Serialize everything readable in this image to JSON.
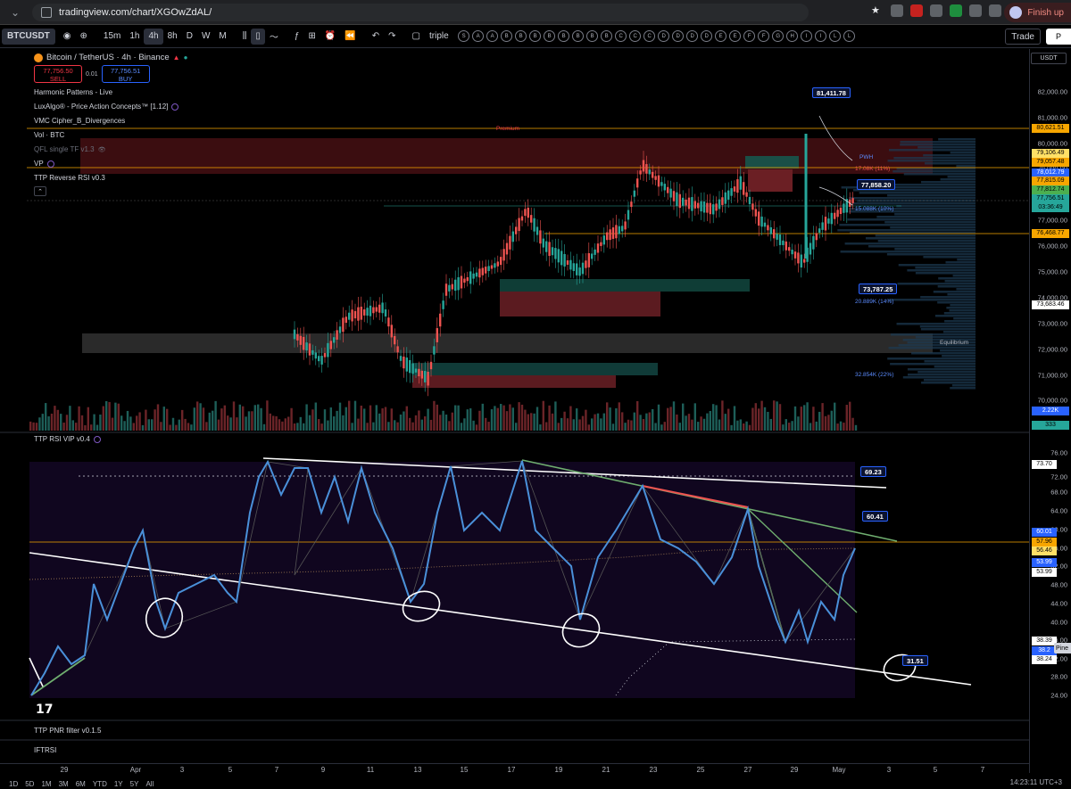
{
  "browser": {
    "url": "tradingview.com/chart/XGOwZdAL/",
    "finish_label": "Finish up"
  },
  "toolbar": {
    "symbol": "BTCUSDT",
    "intervals": [
      "15m",
      "1h",
      "4h",
      "8h",
      "D",
      "W",
      "M"
    ],
    "active_interval": "4h",
    "layout_name": "triple",
    "pattern_letters": [
      "S",
      "A",
      "A",
      "B",
      "B",
      "B",
      "B",
      "B",
      "B",
      "B",
      "B",
      "C",
      "C",
      "C",
      "D",
      "D",
      "D",
      "D",
      "E",
      "E",
      "F",
      "F",
      "G",
      "H",
      "I",
      "I",
      "L",
      "L"
    ],
    "trade_label": "Trade",
    "publish_label": "P"
  },
  "legend": {
    "title": "Bitcoin / TetherUS · 4h · Binance",
    "sell_price": "77,756.50",
    "sell_label": "SELL",
    "spread": "0.01",
    "buy_price": "77,756.51",
    "buy_label": "BUY",
    "indicators": [
      "Harmonic Patterns - Live",
      "LuxAlgo® - Price Action Concepts™ [1.12]",
      "VMC Cipher_B_Divergences",
      "Vol · BTC",
      "QFL single TF v1.3",
      "VP",
      "TTP Reverse RSI v0.3"
    ]
  },
  "currency_chip": "USDT",
  "price_axis": {
    "labels": [
      "82,000.00",
      "81,000.00",
      "80,000.00",
      "79,000.00",
      "78,000.00",
      "77,000.00",
      "76,000.00",
      "75,000.00",
      "74,000.00",
      "73,000.00",
      "72,000.00",
      "71,000.00",
      "70,000.00"
    ],
    "tags": [
      {
        "text": "80,621.51",
        "color": "#f7a600"
      },
      {
        "text": "79,106.49",
        "color": "#ffe066"
      },
      {
        "text": "79,057.48",
        "color": "#f7a600"
      },
      {
        "text": "78,012.79",
        "color": "#2962ff"
      },
      {
        "text": "77,815.09",
        "color": "#f7a600"
      },
      {
        "text": "77,812.74",
        "color": "#4caf50"
      },
      {
        "text": "77,756.51",
        "color": "#26a69a"
      },
      {
        "text": "03:36:49",
        "color": "#26a69a"
      },
      {
        "text": "76,468.77",
        "color": "#f7a600"
      },
      {
        "text": "73,683.46",
        "color": "#ffffff"
      },
      {
        "text": "2.22K",
        "color": "#2962ff"
      },
      {
        "text": "333",
        "color": "#26a69a"
      }
    ],
    "rsi_labels": [
      "76.00",
      "72.00",
      "68.00",
      "64.00",
      "60.00",
      "56.00",
      "52.00",
      "48.00",
      "44.00",
      "40.00",
      "36.00",
      "32.00",
      "28.00",
      "24.00"
    ],
    "rsi_tags": [
      {
        "text": "73.70",
        "color": "#ffffff"
      },
      {
        "text": "60.01",
        "color": "#2962ff"
      },
      {
        "text": "57.96",
        "color": "#f7a600"
      },
      {
        "text": "56.46",
        "color": "#ffe066"
      },
      {
        "text": "53.99",
        "color": "#2962ff"
      },
      {
        "text": "53.99",
        "color": "#ffffff"
      },
      {
        "text": "38.39",
        "color": "#ffffff"
      },
      {
        "text": "38.2",
        "color": "#2962ff"
      },
      {
        "text": "38.24",
        "color": "#ffffff"
      }
    ]
  },
  "callouts": {
    "high": "81,411.78",
    "current": "77,858.20",
    "low": "73,787.25",
    "rsi_upper": "69.23",
    "rsi_now": "60.41",
    "rsi_lower": "31.51"
  },
  "chart_annotations": {
    "premium": "Premium",
    "equilibrium": "Equilibrium",
    "pwh": "PWH",
    "vp_1": "17.08K (11%)",
    "vp_2": "15.088K (10%)",
    "vp_3": "20.889K (14%)",
    "vp_4": "32.854K (22%)"
  },
  "panes": {
    "rsi_title": "TTP RSI VIP v0.4",
    "pnr_title": "TTP PNR filter v0.1.5",
    "iftrsi_title": "IFTRSI"
  },
  "time_axis": [
    "29",
    "Apr",
    "3",
    "5",
    "7",
    "9",
    "11",
    "13",
    "15",
    "17",
    "19",
    "21",
    "23",
    "25",
    "27",
    "29",
    "May",
    "3",
    "5",
    "7"
  ],
  "bottom": {
    "ranges": [
      "1D",
      "5D",
      "1M",
      "3M",
      "6M",
      "YTD",
      "1Y",
      "5Y",
      "All"
    ],
    "clock": "14:23:11 UTC+3",
    "side_tip": "Pine"
  }
}
